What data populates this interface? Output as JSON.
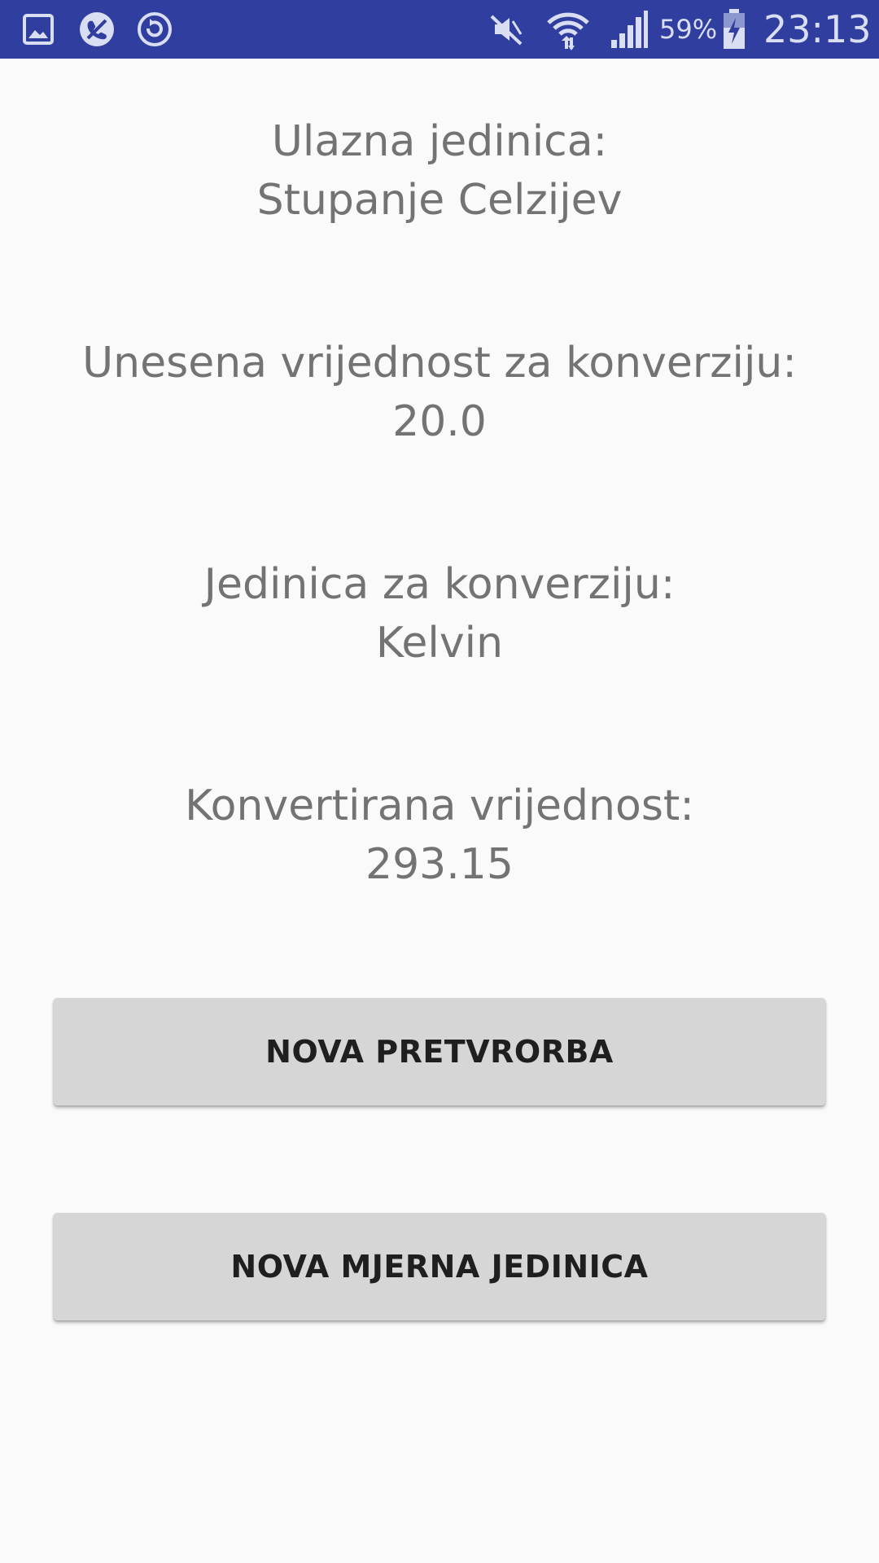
{
  "status_bar": {
    "background": "#303f9f",
    "left_icons": [
      "gallery-icon",
      "blocked-call-icon",
      "sync-icon"
    ],
    "right_icons": [
      "mute-icon",
      "wifi-icon",
      "signal-icon",
      "battery-charging-icon"
    ],
    "battery_percent": "59%",
    "time": "23:13"
  },
  "conversion": {
    "input_unit_label": "Ulazna jedinica:",
    "input_unit_value": "Stupanje Celzijev",
    "entered_value_label": "Unesena vrijednost za konverziju:",
    "entered_value": "20.0",
    "target_unit_label": "Jedinica za konverziju:",
    "target_unit_value": "Kelvin",
    "converted_value_label": "Konvertirana vrijednost:",
    "converted_value": "293.15"
  },
  "actions": {
    "new_conversion_label": "NOVA PRETVRORBA",
    "new_unit_label": "NOVA MJERNA JEDINICA"
  },
  "colors": {
    "background": "#fafafa",
    "text": "#737373",
    "button": "#d6d6d6",
    "button_text": "#1f1f1f"
  }
}
